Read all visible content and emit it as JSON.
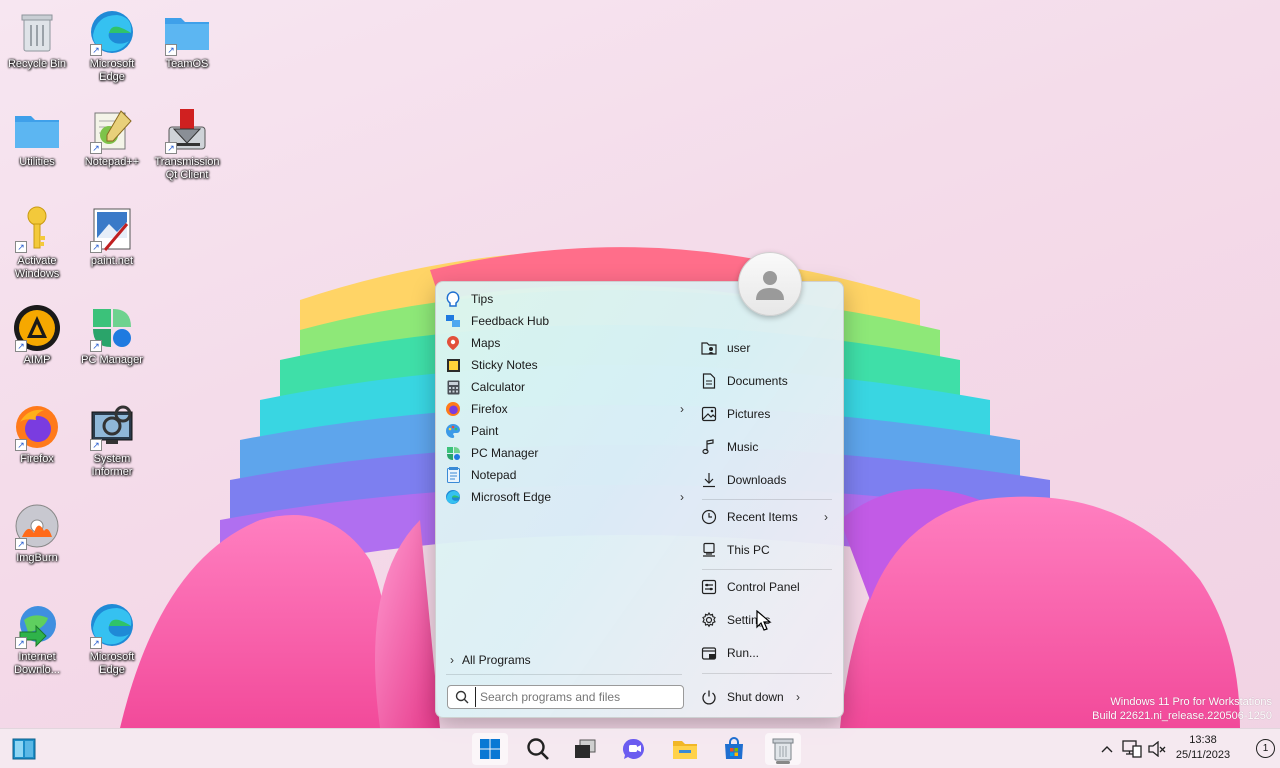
{
  "desktop": {
    "icons": [
      {
        "label": "Recycle Bin"
      },
      {
        "label": "Microsoft Edge"
      },
      {
        "label": "TeamOS"
      },
      {
        "label": "Utilities"
      },
      {
        "label": "Notepad++"
      },
      {
        "label": "Transmission Qt Client"
      },
      {
        "label": "Activate Windows"
      },
      {
        "label": "paint.net"
      },
      {
        "label": "AIMP"
      },
      {
        "label": "PC Manager"
      },
      {
        "label": "Firefox"
      },
      {
        "label": "System Informer"
      },
      {
        "label": "ImgBurn"
      },
      {
        "label": "Internet Downlo..."
      },
      {
        "label": "Microsoft Edge"
      }
    ]
  },
  "start_menu": {
    "programs": [
      {
        "label": "Tips",
        "icon": "tips-icon"
      },
      {
        "label": "Feedback Hub",
        "icon": "feedback-hub-icon"
      },
      {
        "label": "Maps",
        "icon": "maps-icon"
      },
      {
        "label": "Sticky Notes",
        "icon": "sticky-notes-icon"
      },
      {
        "label": "Calculator",
        "icon": "calculator-icon"
      },
      {
        "label": "Firefox",
        "icon": "firefox-icon"
      },
      {
        "label": "Paint",
        "icon": "paint-icon"
      },
      {
        "label": "PC Manager",
        "icon": "pc-manager-icon"
      },
      {
        "label": "Notepad",
        "icon": "notepad-icon"
      },
      {
        "label": "Microsoft Edge",
        "icon": "edge-icon"
      }
    ],
    "all_programs": "All Programs",
    "search_placeholder": "Search programs and files",
    "right": {
      "user": "user",
      "documents": "Documents",
      "pictures": "Pictures",
      "music": "Music",
      "downloads": "Downloads",
      "recent_items": "Recent Items",
      "this_pc": "This PC",
      "control_panel": "Control Panel",
      "settings": "Settings",
      "run": "Run...",
      "shut_down": "Shut down"
    }
  },
  "watermark": {
    "line1": "Windows 11 Pro for Workstations",
    "line2": "Build 22621.ni_release.220506-1250"
  },
  "taskbar": {
    "time": "13:38",
    "date": "25/11/2023",
    "notifications": "1"
  },
  "colors": {
    "accent": "#0067c0",
    "menu_bg": "#e3f2ef",
    "taskbar_bg": "#f5e9f0"
  }
}
